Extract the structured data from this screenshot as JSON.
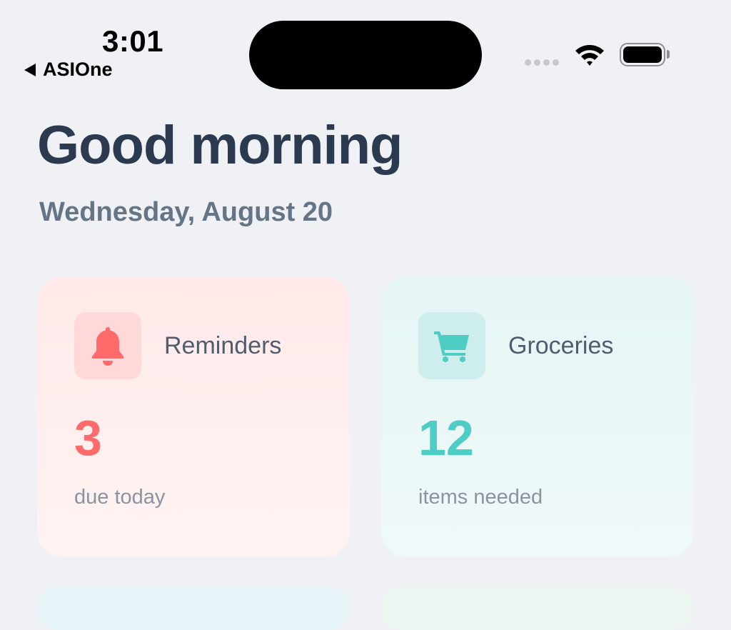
{
  "status_bar": {
    "time": "3:01",
    "back_app": "ASIOne"
  },
  "header": {
    "greeting": "Good morning",
    "date": "Wednesday, August 20"
  },
  "cards": [
    {
      "title": "Reminders",
      "count": "3",
      "subtitle": "due today",
      "icon": "bell-icon",
      "accent": "#ff6b6b"
    },
    {
      "title": "Groceries",
      "count": "12",
      "subtitle": "items needed",
      "icon": "cart-icon",
      "accent": "#4ecdc4"
    }
  ]
}
